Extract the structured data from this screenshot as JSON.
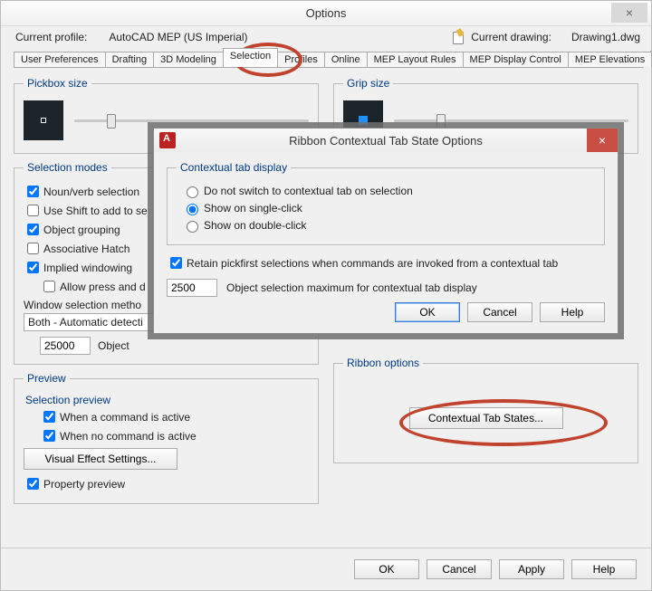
{
  "window": {
    "title": "Options",
    "profile_label": "Current profile:",
    "profile_value": "AutoCAD MEP (US Imperial)",
    "drawing_label": "Current drawing:",
    "drawing_value": "Drawing1.dwg"
  },
  "tabs": {
    "items": [
      "User Preferences",
      "Drafting",
      "3D Modeling",
      "Selection",
      "Profiles",
      "Online",
      "MEP Layout Rules",
      "MEP Display Control",
      "MEP Elevations"
    ],
    "active": "Selection"
  },
  "left": {
    "pickbox_legend": "Pickbox size",
    "selmodes_legend": "Selection modes",
    "noun_verb": "Noun/verb selection",
    "use_shift": "Use Shift to add to se",
    "obj_group": "Object grouping",
    "assoc_hatch": "Associative Hatch",
    "implied": "Implied windowing",
    "allow_press": "Allow press and d",
    "winsel_label": "Window selection metho",
    "winsel_value": "Both - Automatic detecti",
    "sel_max_value": "25000",
    "sel_max_label": "Object",
    "preview_legend": "Preview",
    "sel_preview_label": "Selection preview",
    "cmd_active": "When a command is active",
    "cmd_inactive": "When no command is active",
    "visual_btn": "Visual Effect Settings...",
    "prop_preview": "Property preview"
  },
  "right": {
    "grip_legend": "Grip size",
    "ribbon_legend": "Ribbon options",
    "ctx_btn": "Contextual Tab States..."
  },
  "modal": {
    "title": "Ribbon Contextual Tab State Options",
    "group_legend": "Contextual tab display",
    "r1": "Do not switch to contextual tab on selection",
    "r2": "Show on single-click",
    "r3": "Show on double-click",
    "retain": "Retain pickfirst selections when commands are invoked from a contextual tab",
    "max_value": "2500",
    "max_label": "Object selection maximum for contextual tab display",
    "ok": "OK",
    "cancel": "Cancel",
    "help": "Help"
  },
  "footer": {
    "ok": "OK",
    "cancel": "Cancel",
    "apply": "Apply",
    "help": "Help"
  }
}
